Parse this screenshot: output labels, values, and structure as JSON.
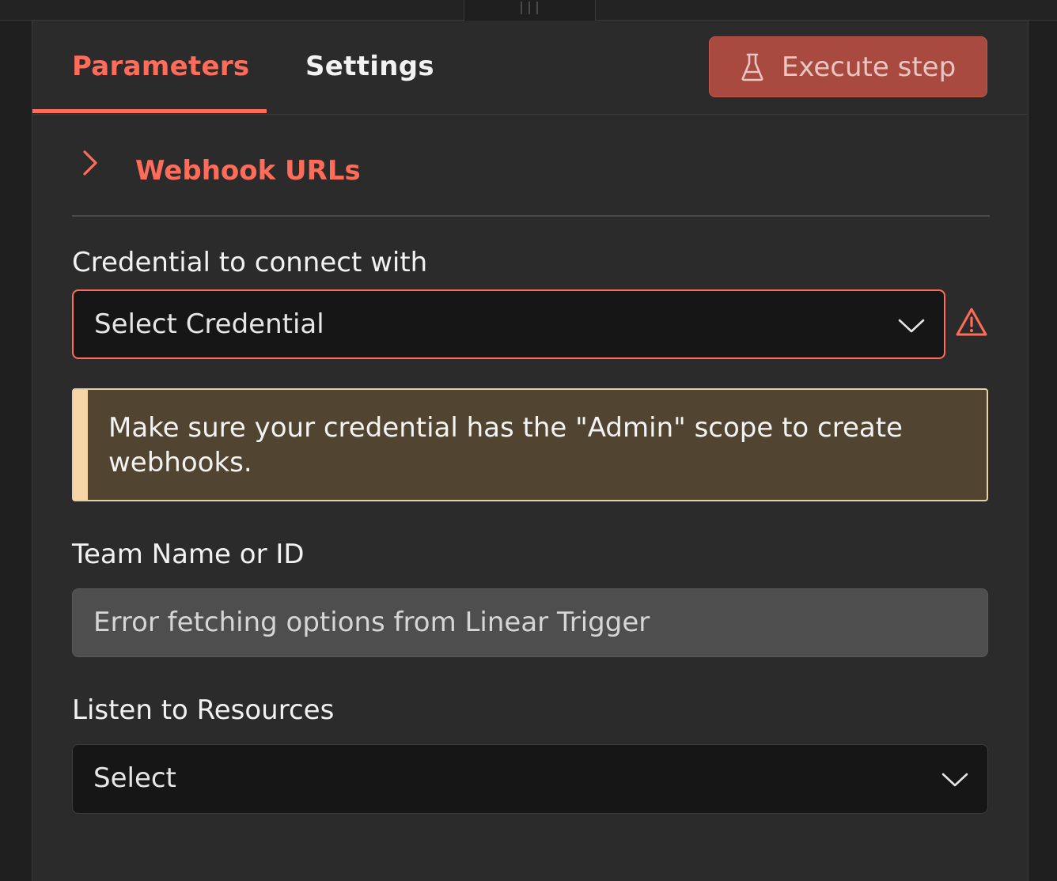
{
  "tabs": {
    "parameters_label": "Parameters",
    "settings_label": "Settings"
  },
  "toolbar": {
    "execute_label": "Execute step"
  },
  "section": {
    "webhook_title": "Webhook URLs"
  },
  "fields": {
    "credential": {
      "label": "Credential to connect with",
      "value": "Select Credential"
    },
    "notice": {
      "text": "Make sure your credential has the \"Admin\" scope to create webhooks."
    },
    "team": {
      "label": "Team Name or ID",
      "value": "Error fetching options from Linear Trigger"
    },
    "resources": {
      "label": "Listen to Resources",
      "value": "Select"
    }
  },
  "icons": {
    "execute": "flask-icon",
    "section_toggle": "chevron-right-icon",
    "dropdown": "chevron-down-icon",
    "warning": "warning-triangle-icon"
  },
  "colors": {
    "accent": "#ff6d5a",
    "execute_button": "#a84a40",
    "notice_background": "#514430",
    "notice_border": "#f6d6a6",
    "panel_background": "#2b2b2b"
  }
}
